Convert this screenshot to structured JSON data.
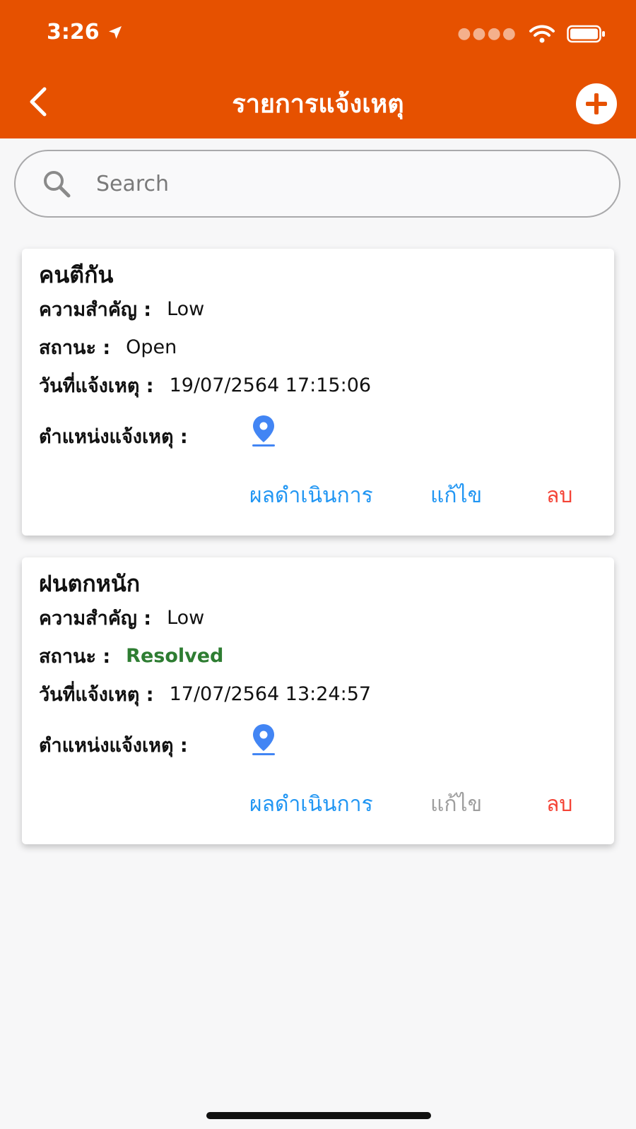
{
  "status_bar": {
    "time": "3:26"
  },
  "nav": {
    "title": "รายการแจ้งเหตุ"
  },
  "search": {
    "placeholder": "Search"
  },
  "labels": {
    "priority": "ความสำคัญ :",
    "status": "สถานะ :",
    "date": "วันที่แจ้งเหตุ :",
    "location": "ตำแหน่งแจ้งเหตุ :"
  },
  "actions": {
    "result": "ผลดำเนินการ",
    "edit": "แก้ไข",
    "delete": "ลบ"
  },
  "reports": [
    {
      "title": "คนตีกัน",
      "priority": "Low",
      "status": "Open",
      "date": "19/07/2564 17:15:06"
    },
    {
      "title": "ฝนตกหนัก",
      "priority": "Low",
      "status": "Resolved",
      "date": "17/07/2564 13:24:57"
    }
  ],
  "colors": {
    "header": "#e65100",
    "link_blue": "#2196f3",
    "delete_red": "#f44336",
    "disabled_gray": "#9e9e9e",
    "resolved_green": "#2e7d32",
    "pin_blue": "#4285f4"
  }
}
